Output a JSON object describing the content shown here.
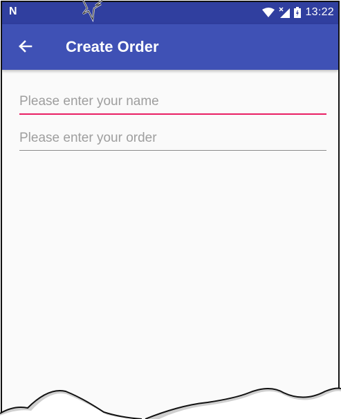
{
  "status_bar": {
    "carrier_icon": "N",
    "time": "13:22",
    "icons": [
      "wifi-icon",
      "signal-icon",
      "battery-icon"
    ]
  },
  "toolbar": {
    "title": "Create Order",
    "back_icon": "arrow-left-icon"
  },
  "form": {
    "name_field": {
      "placeholder": "Please enter your name",
      "value": ""
    },
    "order_field": {
      "placeholder": "Please enter your order",
      "value": ""
    }
  },
  "colors": {
    "status_bar": "#303f9f",
    "toolbar": "#3f51b5",
    "accent": "#e91e63",
    "background": "#fafafa"
  }
}
